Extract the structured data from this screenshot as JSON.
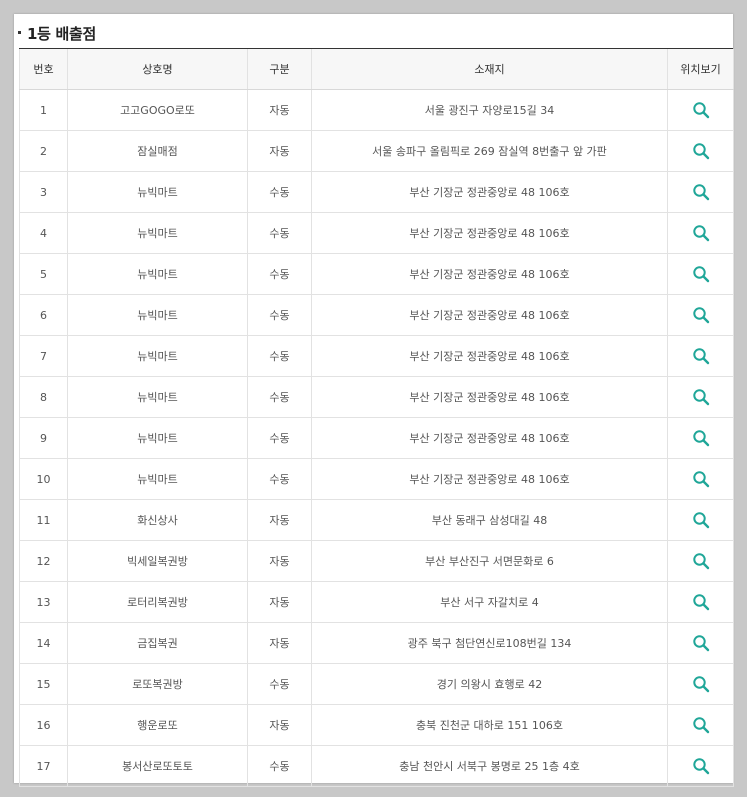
{
  "section": {
    "title": "1등 배출점"
  },
  "table": {
    "headers": [
      "번호",
      "상호명",
      "구분",
      "소재지",
      "위치보기"
    ],
    "rows": [
      {
        "no": "1",
        "name": "고고GOGO로또",
        "type": "자동",
        "addr": "서울 광진구 자양로15길 34"
      },
      {
        "no": "2",
        "name": "잠실매점",
        "type": "자동",
        "addr": "서울 송파구 올림픽로 269 잠실역 8번출구 앞 가판"
      },
      {
        "no": "3",
        "name": "뉴빅마트",
        "type": "수동",
        "addr": "부산 기장군 정관중앙로 48 106호"
      },
      {
        "no": "4",
        "name": "뉴빅마트",
        "type": "수동",
        "addr": "부산 기장군 정관중앙로 48 106호"
      },
      {
        "no": "5",
        "name": "뉴빅마트",
        "type": "수동",
        "addr": "부산 기장군 정관중앙로 48 106호"
      },
      {
        "no": "6",
        "name": "뉴빅마트",
        "type": "수동",
        "addr": "부산 기장군 정관중앙로 48 106호"
      },
      {
        "no": "7",
        "name": "뉴빅마트",
        "type": "수동",
        "addr": "부산 기장군 정관중앙로 48 106호"
      },
      {
        "no": "8",
        "name": "뉴빅마트",
        "type": "수동",
        "addr": "부산 기장군 정관중앙로 48 106호"
      },
      {
        "no": "9",
        "name": "뉴빅마트",
        "type": "수동",
        "addr": "부산 기장군 정관중앙로 48 106호"
      },
      {
        "no": "10",
        "name": "뉴빅마트",
        "type": "수동",
        "addr": "부산 기장군 정관중앙로 48 106호"
      },
      {
        "no": "11",
        "name": "화신상사",
        "type": "자동",
        "addr": "부산 동래구 삼성대길 48"
      },
      {
        "no": "12",
        "name": "빅세일복권방",
        "type": "자동",
        "addr": "부산 부산진구 서면문화로 6"
      },
      {
        "no": "13",
        "name": "로터리복권방",
        "type": "자동",
        "addr": "부산 서구 자갈치로 4"
      },
      {
        "no": "14",
        "name": "금집복권",
        "type": "자동",
        "addr": "광주 북구 첨단연신로108번길 134"
      },
      {
        "no": "15",
        "name": "로또복권방",
        "type": "수동",
        "addr": "경기 의왕시 효행로 42"
      },
      {
        "no": "16",
        "name": "행운로또",
        "type": "자동",
        "addr": "충북 진천군 대하로 151 106호"
      },
      {
        "no": "17",
        "name": "봉서산로또토토",
        "type": "수동",
        "addr": "충남 천안시 서북구 봉명로 25 1층 4호"
      }
    ]
  },
  "icons": {
    "location": "search-icon"
  },
  "colors": {
    "accent": "#1fa698"
  }
}
